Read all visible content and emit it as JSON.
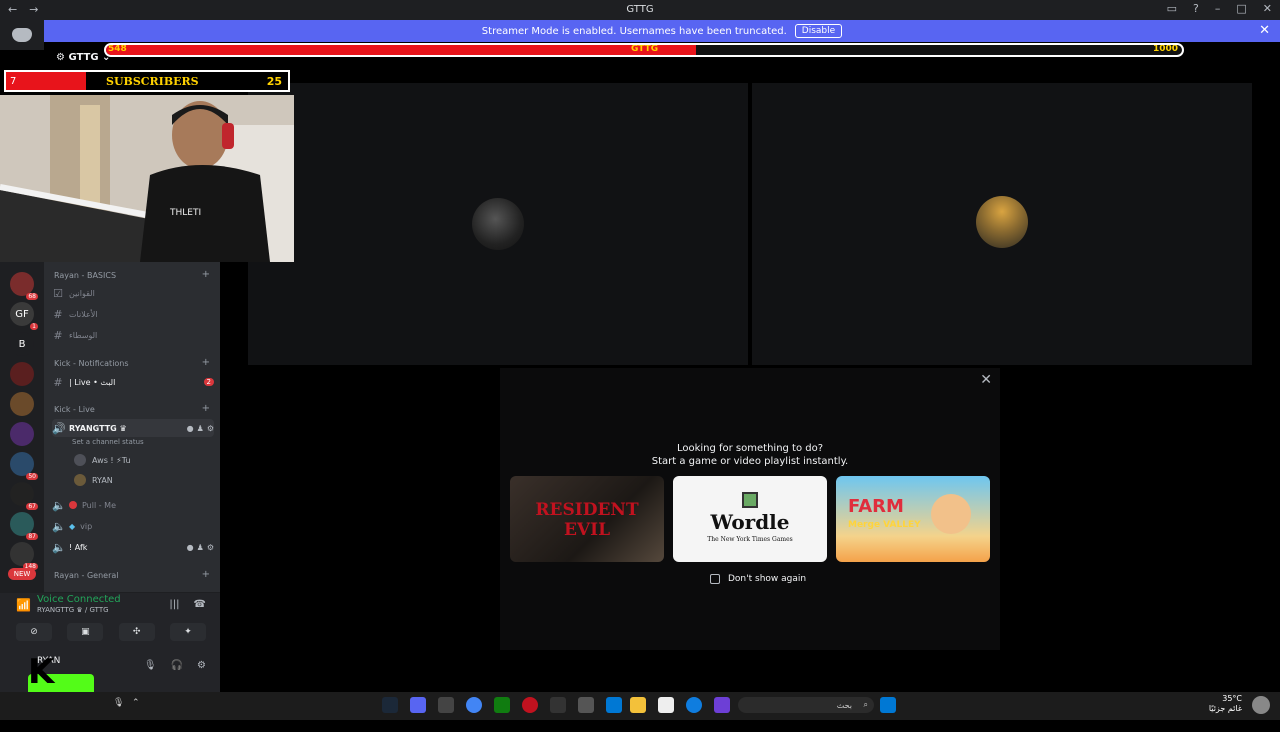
{
  "window": {
    "title": "GTTG"
  },
  "streamer_banner": {
    "message": "Streamer Mode is enabled. Usernames have been truncated.",
    "disable_label": "Disable"
  },
  "overlay": {
    "hp_left": "548",
    "hp_center": "GTTG",
    "hp_right": "1000",
    "hp_fraction": 0.548,
    "subs_count_left": "7",
    "subs_label": "SUBSCRIBERS",
    "subs_count": "25",
    "k9_logo": "K 9"
  },
  "server": {
    "name": "GTTG"
  },
  "guilds": [
    {
      "label": "",
      "badge": "68",
      "color": "#7a2c2c"
    },
    {
      "label": "GF",
      "badge": "1",
      "color": "#3a3a3a"
    },
    {
      "label": "B",
      "badge": "",
      "color": "#1e1f22"
    },
    {
      "label": "",
      "badge": "",
      "color": "#5a1f1f"
    },
    {
      "label": "",
      "badge": "",
      "color": "#6a4a2a"
    },
    {
      "label": "",
      "badge": "",
      "color": "#4b2a6a"
    },
    {
      "label": "",
      "badge": "50",
      "color": "#2a4a6a"
    },
    {
      "label": "",
      "badge": "67",
      "color": "#222"
    },
    {
      "label": "",
      "badge": "87",
      "color": "#2a5a5a"
    },
    {
      "label": "",
      "badge": "148",
      "color": "#333"
    }
  ],
  "new_badge": "NEW",
  "channels": {
    "cat_basics": "Rayan - BASICS",
    "rules": "القوانين",
    "announcements": "الأعلانات",
    "mediators": "الوسطاء",
    "cat_notifications": "Kick - Notifications",
    "live": "| Live • البث",
    "live_badge": "2",
    "cat_live": "Kick - Live",
    "voice_active": "RYANGTTG ♛",
    "channel_status": "Set a channel status",
    "voice_user1": "Aws ! ⚡Tu",
    "voice_user2": "RYAN",
    "pull_me": "Pull - Me",
    "vip": "vip",
    "afk": "! Afk",
    "cat_general": "Rayan - General"
  },
  "voice_panel": {
    "status": "Voice Connected",
    "location": "RYANGTTG ♛ / GTTG"
  },
  "user_panel": {
    "name": "RYAN"
  },
  "activity": {
    "heading1": "Looking for something to do?",
    "heading2": "Start a game or video playlist instantly.",
    "games": [
      {
        "title": "RESIDENT EVIL",
        "subtitle": ""
      },
      {
        "title": "Wordle",
        "subtitle": "The New York Times Games"
      },
      {
        "title": "FARM",
        "subtitle": "Merge VALLEY"
      }
    ],
    "dont_show_label": "Don't show again"
  },
  "taskbar": {
    "search_placeholder": "بحث",
    "temperature": "35°C",
    "weather": "غائم جزئيًا"
  }
}
